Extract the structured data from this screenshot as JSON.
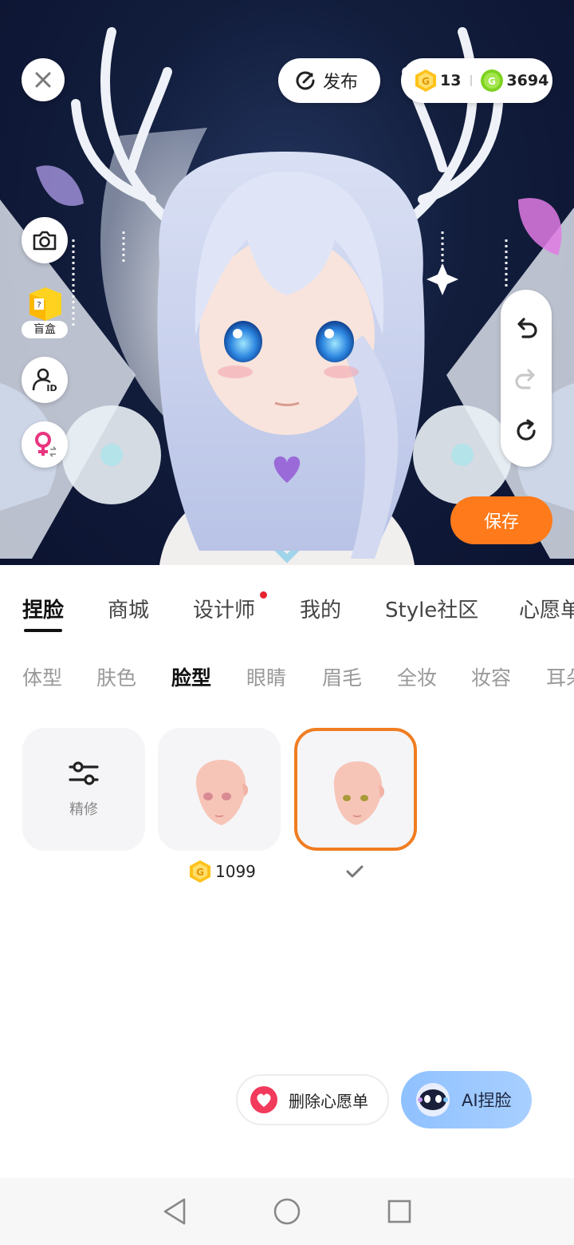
{
  "topbar": {
    "publish_label": "发布",
    "gold_coins": "13",
    "green_coins": "3694"
  },
  "side_tools": {
    "blindbox_label": "盲盒"
  },
  "save_label": "保存",
  "main_tabs": [
    {
      "label": "捏脸",
      "active": true
    },
    {
      "label": "商城"
    },
    {
      "label": "设计师",
      "badge": true
    },
    {
      "label": "我的"
    },
    {
      "label": "Style社区"
    },
    {
      "label": "心愿单"
    }
  ],
  "sub_tabs": [
    {
      "label": "体型"
    },
    {
      "label": "肤色"
    },
    {
      "label": "脸型",
      "active": true
    },
    {
      "label": "眼睛"
    },
    {
      "label": "眉毛"
    },
    {
      "label": "全妆"
    },
    {
      "label": "妆容"
    },
    {
      "label": "耳朵"
    }
  ],
  "items": {
    "adjust_label": "精修",
    "face1_price": "1099"
  },
  "actions": {
    "wishlist_label": "删除心愿单",
    "ai_label": "AI捏脸"
  },
  "colors": {
    "accent": "#ff7a1a",
    "selected_border": "#f07d22",
    "tab_badge": "#e8222f",
    "ai_button": "#9cc8ff"
  }
}
